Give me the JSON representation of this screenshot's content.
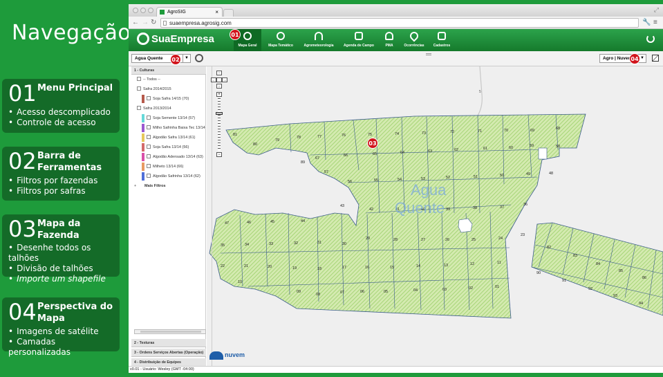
{
  "headline": "Navegação",
  "cards": [
    {
      "num": "01",
      "title": "Menu Principal",
      "bullets": [
        "Acesso descomplicado",
        "Controle de acesso"
      ]
    },
    {
      "num": "02",
      "title": "Barra de Ferramentas",
      "bullets": [
        "Filtros por fazendas",
        "Filtros por safras"
      ]
    },
    {
      "num": "03",
      "title": "Mapa da Fazenda",
      "bullets": [
        "Desenhe todos os talhões",
        "Divisão de talhões",
        "Importe um shapefile"
      ]
    },
    {
      "num": "04",
      "title": "Perspectiva do Mapa",
      "bullets": [
        "Imagens de satélite",
        "Camadas personalizadas"
      ]
    }
  ],
  "browser": {
    "tab_title": "AgroSIG",
    "url": "suaempresa.agrosig.com"
  },
  "app": {
    "brand": "SuaEmpresa",
    "menu": [
      "Mapa Geral",
      "Mapa Temático",
      "Agrometeorologia",
      "Agenda de Campo",
      "PMA",
      "Ocorrências",
      "Cadastros"
    ],
    "active_menu": "Mapa Geral"
  },
  "toolbar": {
    "farm": "Agua Quente",
    "layer": "Agro | Nuvem"
  },
  "badges": [
    "01",
    "02",
    "03",
    "04"
  ],
  "sidebar": {
    "section1": "1 - Culturas",
    "todos": "-- Todos --",
    "safra1": "Safra 2014/2015",
    "safra1_items": [
      {
        "label": "Soja Safra 14/15 (70)",
        "color": "#b65a4c"
      }
    ],
    "safra2": "Safra 2013/2014",
    "safra2_items": [
      {
        "label": "Soja Semente 13/14 (57)",
        "color": "#66d9d9"
      },
      {
        "label": "Milho Safrinha Baixa Tec 13/14",
        "color": "#9b59d0"
      },
      {
        "label": "Algodão Safra 13/14 (61)",
        "color": "#e6c85a"
      },
      {
        "label": "Soja Safra 13/14 (56)",
        "color": "#d36a6a"
      },
      {
        "label": "Algodão Adensado 13/14 (63)",
        "color": "#d94fa8"
      },
      {
        "label": "Milheto 13/14 (66)",
        "color": "#e89a62"
      },
      {
        "label": "Algodão Safrinha 13/14 (62)",
        "color": "#4f6fd9"
      }
    ],
    "more_filters": "Mais Filtros",
    "section2": "2 - Texturas",
    "section3": "3 - Ordens Serviços Abertas (Operação)",
    "section4": "4 - Distribuição de Equipes"
  },
  "map": {
    "farm_label": [
      "Agua",
      "Quente"
    ],
    "watermark": "nuvem",
    "road_marker": "5",
    "plots_main": [
      "81",
      "80",
      "79",
      "78",
      "77",
      "76",
      "75",
      "74",
      "73",
      "72",
      "71",
      "70",
      "69",
      "68",
      "67",
      "66",
      "65",
      "64",
      "63",
      "62",
      "61",
      "60",
      "59",
      "58",
      "89",
      "57",
      "56",
      "55",
      "54",
      "53",
      "52",
      "51",
      "50",
      "49",
      "48",
      "43",
      "42",
      "41",
      "40",
      "39",
      "38",
      "37",
      "36",
      "47",
      "46",
      "45",
      "44",
      "35",
      "34",
      "33",
      "32",
      "31",
      "30",
      "29",
      "28",
      "27",
      "26",
      "25",
      "24",
      "23",
      "22",
      "21",
      "20",
      "19",
      "18",
      "17",
      "16",
      "15",
      "14",
      "13",
      "12",
      "11",
      "10",
      "09",
      "08",
      "07",
      "06",
      "05",
      "04",
      "03",
      "02",
      "01"
    ],
    "plots_east": [
      "82",
      "83",
      "84",
      "85",
      "86",
      "90",
      "91",
      "92",
      "93",
      "94"
    ]
  },
  "status": "v0.01 - Usuário: Wesley (GMT -04:00)"
}
